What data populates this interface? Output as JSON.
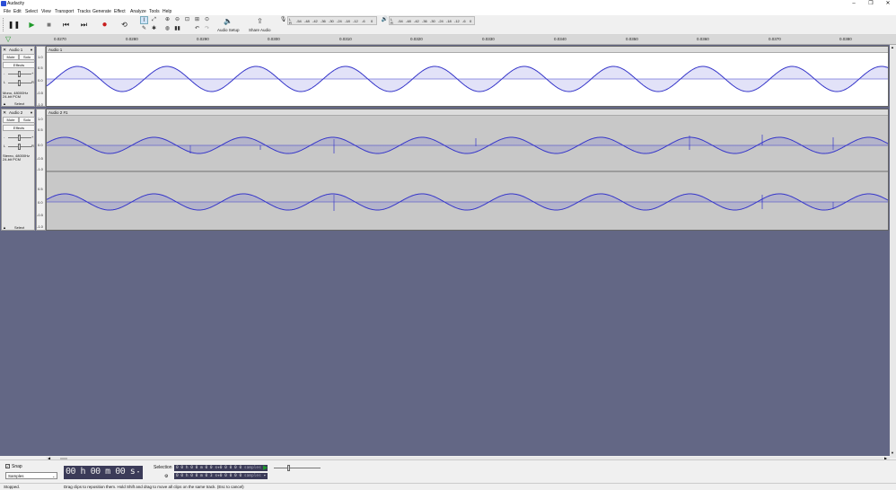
{
  "app": {
    "title": "Audacity"
  },
  "window_buttons": {
    "minimize": "–",
    "maximize": "❐",
    "close": "✕"
  },
  "menus": [
    "File",
    "Edit",
    "Select",
    "View",
    "Transport",
    "Tracks",
    "Generate",
    "Effect",
    "Analyze",
    "Tools",
    "Help"
  ],
  "toolbar": {
    "audio_setup_label": "Audio Setup",
    "share_audio_label": "Share Audio",
    "record_meter_labels": [
      "L",
      "R",
      "-54",
      "-48",
      "-42",
      "-36",
      "-30",
      "-24",
      "-18",
      "-12",
      "-6",
      "0"
    ],
    "play_meter_labels": [
      "L",
      "R",
      "-54",
      "-48",
      "-42",
      "-36",
      "-30",
      "-24",
      "-18",
      "-12",
      "-6",
      "0"
    ]
  },
  "ruler": {
    "ticks": [
      "0.0270",
      "0.0280",
      "0.0290",
      "0.0300",
      "0.0310",
      "0.0320",
      "0.0330",
      "0.0340",
      "0.0350",
      "0.0360",
      "0.0370",
      "0.0380"
    ]
  },
  "tracks": [
    {
      "name": "Audio 1",
      "clip_name": "Audio 1",
      "mute": "Mute",
      "solo": "Solo",
      "effects": "Effects",
      "gain_minus": "-",
      "gain_plus": "+",
      "pan_left": "L",
      "pan_right": "R",
      "info": "Mono, 48000Hz\n24-bit PCM",
      "select": "Select",
      "scale": [
        "1.0",
        "0.5",
        "0.0",
        "-0.5",
        "-1.0"
      ]
    },
    {
      "name": "Audio 2",
      "clip_name": "Audio 2 #1",
      "mute": "Mute",
      "solo": "Solo",
      "effects": "Effects",
      "gain_minus": "-",
      "gain_plus": "+",
      "pan_left": "L",
      "pan_right": "R",
      "info": "Stereo, 48000Hz\n24-bit PCM",
      "select": "Select",
      "scale_top": [
        "1.0",
        "0.5",
        "0.0",
        "-0.5",
        "-1.0"
      ],
      "scale_bottom": [
        "0.5",
        "0.0",
        "-0.5",
        "-1.0"
      ]
    }
  ],
  "bottom": {
    "snap_label": "Snap",
    "snap_unit": "Samples",
    "time_display": "00 h 00 m 00 s",
    "selection_label": "Selection",
    "selection_start": "0 0 h 0 0 m 0 0 s+0 0 0 0 0",
    "selection_end": "0 0 h 0 0 m 0 3 s+0 0 0 0 0",
    "selection_unit": "samples"
  },
  "status": {
    "state": "Stopped.",
    "message": "Drag clips to reposition them. Hold Shift and drag to move all clips on the same track. (Esc to cancel)"
  },
  "colors": {
    "wave": "#3232c8",
    "project_bg": "#636785",
    "track_bg": "#ffffff",
    "track2_bg": "#c8c8c8"
  }
}
